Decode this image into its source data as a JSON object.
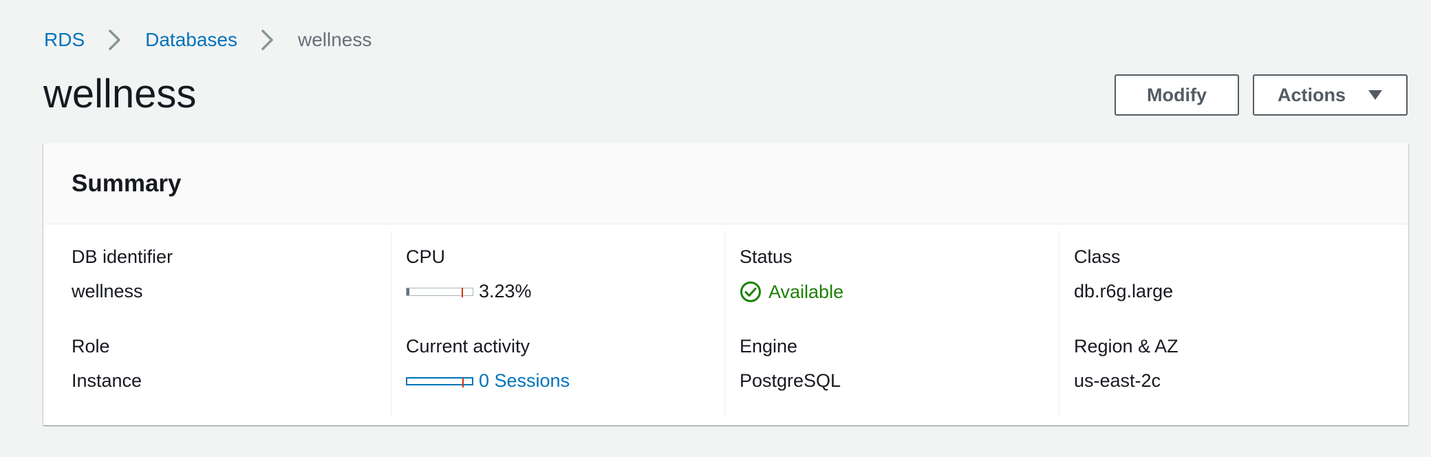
{
  "breadcrumb": {
    "items": [
      {
        "label": "RDS"
      },
      {
        "label": "Databases"
      },
      {
        "label": "wellness"
      }
    ]
  },
  "page": {
    "title": "wellness"
  },
  "header_actions": {
    "modify_label": "Modify",
    "actions_label": "Actions"
  },
  "summary": {
    "title": "Summary",
    "db_identifier": {
      "label": "DB identifier",
      "value": "wellness"
    },
    "role": {
      "label": "Role",
      "value": "Instance"
    },
    "cpu": {
      "label": "CPU",
      "value": "3.23%",
      "fill_fraction": 0.0323
    },
    "current_activity": {
      "label": "Current activity",
      "value": "0 Sessions",
      "fill_fraction": 0
    },
    "status": {
      "label": "Status",
      "value": "Available"
    },
    "engine": {
      "label": "Engine",
      "value": "PostgreSQL"
    },
    "class": {
      "label": "Class",
      "value": "db.r6g.large"
    },
    "region_az": {
      "label": "Region & AZ",
      "value": "us-east-2c"
    }
  },
  "icons": {
    "breadcrumb_separator": "chevron-right-icon",
    "actions_caret": "caret-down-icon",
    "status": "check-circle-icon"
  },
  "colors": {
    "link": "#0073bb",
    "status_available": "#1d8102",
    "threshold": "#d13212",
    "button_border": "#545b64"
  }
}
